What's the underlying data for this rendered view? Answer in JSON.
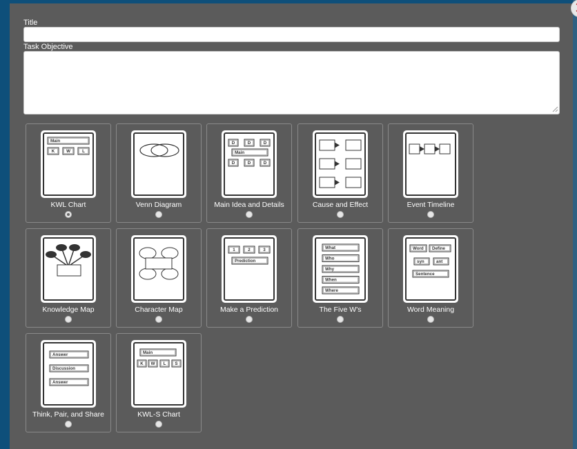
{
  "form": {
    "title_label": "Title",
    "title_value": "",
    "objective_label": "Task Objective",
    "objective_value": ""
  },
  "organizers": [
    {
      "name": "KWL Chart",
      "selected": true,
      "icon": "kwl-chart-icon",
      "tags": [
        "Main",
        "K",
        "W",
        "L"
      ]
    },
    {
      "name": "Venn Diagram",
      "selected": false,
      "icon": "venn-diagram-icon"
    },
    {
      "name": "Main Idea and Details",
      "selected": false,
      "icon": "main-idea-details-icon",
      "tags": [
        "D",
        "D",
        "D",
        "Main",
        "D",
        "D",
        "D"
      ]
    },
    {
      "name": "Cause and Effect",
      "selected": false,
      "icon": "cause-effect-icon"
    },
    {
      "name": "Event Timeline",
      "selected": false,
      "icon": "event-timeline-icon"
    },
    {
      "name": "Knowledge Map",
      "selected": false,
      "icon": "knowledge-map-icon"
    },
    {
      "name": "Character Map",
      "selected": false,
      "icon": "character-map-icon"
    },
    {
      "name": "Make a Prediction",
      "selected": false,
      "icon": "prediction-icon",
      "tags": [
        "1",
        "2",
        "3",
        "Prediction"
      ]
    },
    {
      "name": "The Five W's",
      "selected": false,
      "icon": "five-ws-icon",
      "tags": [
        "What",
        "Who",
        "Why",
        "When",
        "Where"
      ]
    },
    {
      "name": "Word Meaning",
      "selected": false,
      "icon": "word-meaning-icon",
      "tags": [
        "Word",
        "Define",
        "syn",
        "ant",
        "Sentence"
      ]
    },
    {
      "name": "Think, Pair, and Share",
      "selected": false,
      "icon": "think-pair-share-icon",
      "tags": [
        "Answer",
        "Discussion",
        "Answer"
      ]
    },
    {
      "name": "KWL-S Chart",
      "selected": false,
      "icon": "kwls-chart-icon",
      "tags": [
        "Main",
        "K",
        "W",
        "L",
        "S"
      ]
    }
  ]
}
